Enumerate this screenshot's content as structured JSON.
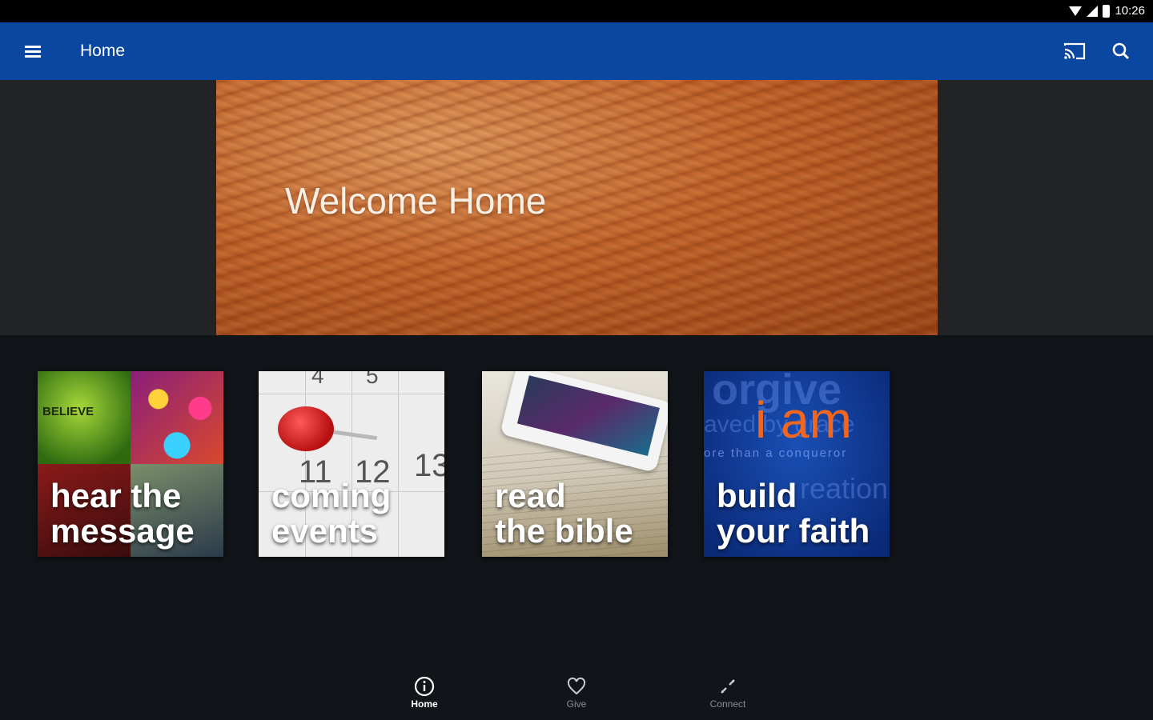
{
  "status_bar": {
    "time": "10:26"
  },
  "app_bar": {
    "title": "Home"
  },
  "hero": {
    "title": "Welcome Home"
  },
  "tiles": [
    {
      "label_line1": "hear the",
      "label_line2": "message",
      "art_text": "BELIEVE"
    },
    {
      "label_line1": "coming",
      "label_line2": "events",
      "art_numbers": [
        "4",
        "5",
        "11",
        "12",
        "13"
      ]
    },
    {
      "label_line1": "read",
      "label_line2": "the bible"
    },
    {
      "label_line1": "build",
      "label_line2": "your faith",
      "art_text": "i am",
      "art_subtext": "ore than a conqueror"
    }
  ],
  "bottom_nav": [
    {
      "label": "Home",
      "icon": "info-icon",
      "active": true
    },
    {
      "label": "Give",
      "icon": "heart-icon",
      "active": false
    },
    {
      "label": "Connect",
      "icon": "connect-icon",
      "active": false
    }
  ],
  "colors": {
    "app_bar": "#0a47a0",
    "background": "#111418",
    "hero_band": "#222324",
    "accent_orange": "#f2661d"
  }
}
